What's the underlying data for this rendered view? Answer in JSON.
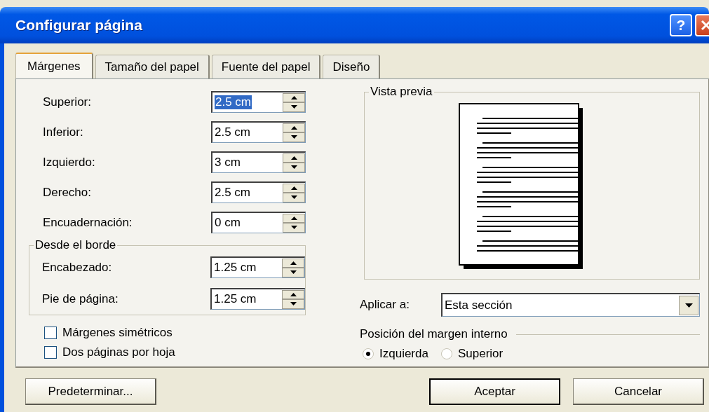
{
  "window": {
    "title": "Configurar página",
    "help_button": "?"
  },
  "tabs": [
    {
      "label": "Márgenes",
      "selected": true
    },
    {
      "label": "Tamaño del papel",
      "selected": false
    },
    {
      "label": "Fuente del papel",
      "selected": false
    },
    {
      "label": "Diseño",
      "selected": false
    }
  ],
  "margins": [
    {
      "label": "Superior:",
      "value": "2.5 cm",
      "text_selected": true
    },
    {
      "label": "Inferior:",
      "value": "2.5 cm",
      "text_selected": false
    },
    {
      "label": "Izquierdo:",
      "value": "3 cm",
      "text_selected": false
    },
    {
      "label": "Derecho:",
      "value": "2.5 cm",
      "text_selected": false
    },
    {
      "label": "Encuadernación:",
      "value": "0 cm",
      "text_selected": false
    }
  ],
  "from_edge": {
    "title": "Desde el borde",
    "fields": [
      {
        "label": "Encabezado:",
        "value": "1.25 cm",
        "text_selected": false
      },
      {
        "label": "Pie de página:",
        "value": "1.25 cm",
        "text_selected": false
      }
    ]
  },
  "checkboxes": [
    {
      "label": "Márgenes simétricos",
      "checked": false
    },
    {
      "label": "Dos páginas por hoja",
      "checked": false
    }
  ],
  "preview": {
    "title": "Vista previa"
  },
  "apply_to": {
    "label": "Aplicar a:",
    "value": "Esta sección"
  },
  "gutter_position": {
    "title": "Posición del margen interno",
    "options": [
      {
        "label": "Izquierda",
        "selected": true
      },
      {
        "label": "Superior",
        "selected": false
      }
    ]
  },
  "buttons": {
    "default": "Predeterminar...",
    "ok": "Aceptar",
    "cancel": "Cancelar"
  }
}
